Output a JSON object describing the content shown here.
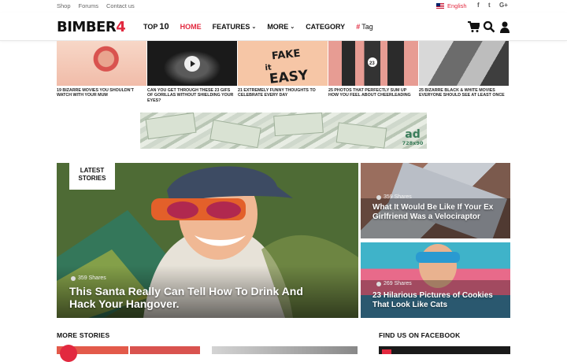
{
  "topbar": {
    "links": [
      "Shop",
      "Forums",
      "Contact us"
    ],
    "language": "English",
    "social": [
      {
        "label": "f",
        "name": "facebook-icon"
      },
      {
        "label": "t",
        "name": "twitter-icon"
      },
      {
        "label": "G+",
        "name": "google-plus-icon"
      }
    ]
  },
  "header": {
    "logo_text": "BIMBER",
    "logo_num": "4",
    "nav": {
      "top10_prefix": "TOP",
      "top10_num": "10",
      "home": "HOME",
      "features": "FEATURES",
      "more": "MORE",
      "category": "CATEGORY",
      "tag_hash": "#",
      "tag": "Tag"
    }
  },
  "strip": [
    {
      "caption": "19 BIZARRE MOVIES YOU SHOULDN'T WATCH WITH YOUR MUM",
      "bg": "#f3c9b6"
    },
    {
      "caption": "CAN YOU GET THROUGH THESE 23 GIFS OF GORILLAS WITHOUT SHIELDING YOUR EYES?",
      "bg": "#1d1d1d"
    },
    {
      "caption": "21 EXTREMELY FUNNY THOUGHTS TO CELEBRATE EVERY DAY",
      "bg": "#f6c8a8",
      "art": "FAKE IT EASY"
    },
    {
      "caption": "25 PHOTOS THAT PERFECTLY SUM UP HOW YOU FEEL ABOUT CHEERLEADING",
      "bg": "#e88b86",
      "art": "23"
    },
    {
      "caption": "25 BIZARRE BLACK & WHITE MOVIES EVERYONE SHOULD SEE AT LEAST ONCE",
      "bg": "#8e8e8e"
    }
  ],
  "ad": {
    "label": "ad",
    "size": "728x90"
  },
  "featured": {
    "badge": "LATEST STORIES",
    "shares": "359 Shares",
    "title": "This Santa Really Can Tell How To Drink And Hack Your Hangover."
  },
  "side_posts": [
    {
      "shares": "359 Shares",
      "title": "What It Would Be Like If Your Ex Girlfriend Was a Velociraptor"
    },
    {
      "shares": "269 Shares",
      "title": "23 Hilarious Pictures of Cookies That Look Like Cats"
    }
  ],
  "sections": {
    "more_stories": "MORE STORIES",
    "facebook": "FIND US ON FACEBOOK"
  },
  "colors": {
    "accent": "#e2293f",
    "text": "#111111"
  }
}
